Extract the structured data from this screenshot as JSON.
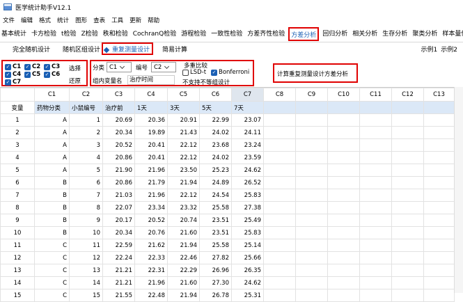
{
  "app": {
    "title": "医学统计助手V12.1"
  },
  "menu": [
    "文件",
    "编辑",
    "格式",
    "统计",
    "图形",
    "查表",
    "工具",
    "更新",
    "帮助"
  ],
  "tabs": [
    "基本统计",
    "卡方检验",
    "t检验",
    "Z检验",
    "秩和检验",
    "CochranQ检验",
    "游程检验",
    "一致性检验",
    "方差齐性检验",
    "方差分析",
    "回归分析",
    "相关分析",
    "生存分析",
    "聚类分析",
    "样本量估算"
  ],
  "active_tab_index": 9,
  "subtabs": [
    "完全随机设计",
    "随机区组设计",
    "重复测量设计",
    "简易计算"
  ],
  "active_subtab_index": 2,
  "examples": [
    "示例1",
    "示例2"
  ],
  "columns_panel": {
    "checkboxes": [
      {
        "label": "C1",
        "checked": true
      },
      {
        "label": "C2",
        "checked": true
      },
      {
        "label": "C3",
        "checked": true
      },
      {
        "label": "C4",
        "checked": true
      },
      {
        "label": "C5",
        "checked": true
      },
      {
        "label": "C6",
        "checked": true
      },
      {
        "label": "C7",
        "checked": true
      }
    ],
    "select_label": "选择",
    "restore_label": "还原"
  },
  "group_panel": {
    "group_label": "分类",
    "group_value": "C1",
    "id_label": "编号",
    "id_value": "C2",
    "within_label": "组内变量名",
    "within_value": "治疗时间"
  },
  "multi_compare": {
    "title": "多重比较",
    "options": [
      {
        "label": "LSD-t",
        "checked": false
      },
      {
        "label": "Bonferroni",
        "checked": true
      }
    ],
    "note": "不支持不等组设计"
  },
  "action": {
    "label": "计算重复测量设计方差分析"
  },
  "grid": {
    "col_headers": [
      "",
      "C1",
      "C2",
      "C3",
      "C4",
      "C5",
      "C6",
      "C7",
      "C8",
      "C9",
      "C10",
      "C11",
      "C12",
      "C13"
    ],
    "var_label": "变量",
    "var_names": [
      "药物分类",
      "小鼠编号",
      "治疗前",
      "1天",
      "3天",
      "5天",
      "7天",
      "",
      "",
      "",
      "",
      "",
      ""
    ],
    "rows": [
      [
        "1",
        "A",
        "1",
        "20.69",
        "20.36",
        "20.91",
        "22.99",
        "23.07"
      ],
      [
        "2",
        "A",
        "2",
        "20.34",
        "19.89",
        "21.43",
        "24.02",
        "24.11"
      ],
      [
        "3",
        "A",
        "3",
        "20.52",
        "20.41",
        "22.12",
        "23.68",
        "23.24"
      ],
      [
        "4",
        "A",
        "4",
        "20.86",
        "20.41",
        "22.12",
        "24.02",
        "23.59"
      ],
      [
        "5",
        "A",
        "5",
        "21.90",
        "21.96",
        "23.50",
        "25.23",
        "24.62"
      ],
      [
        "6",
        "B",
        "6",
        "20.86",
        "21.79",
        "21.94",
        "24.89",
        "26.52"
      ],
      [
        "7",
        "B",
        "7",
        "21.03",
        "21.96",
        "22.12",
        "24.54",
        "25.83"
      ],
      [
        "8",
        "B",
        "8",
        "22.07",
        "23.34",
        "23.32",
        "25.58",
        "27.38"
      ],
      [
        "9",
        "B",
        "9",
        "20.17",
        "20.52",
        "20.74",
        "23.51",
        "25.49"
      ],
      [
        "10",
        "B",
        "10",
        "20.34",
        "20.76",
        "21.60",
        "23.51",
        "25.83"
      ],
      [
        "11",
        "C",
        "11",
        "22.59",
        "21.62",
        "21.94",
        "25.58",
        "25.14"
      ],
      [
        "12",
        "C",
        "12",
        "22.24",
        "22.33",
        "22.46",
        "27.82",
        "25.66"
      ],
      [
        "13",
        "C",
        "13",
        "21.21",
        "22.31",
        "22.29",
        "26.96",
        "26.35"
      ],
      [
        "14",
        "C",
        "14",
        "21.21",
        "21.96",
        "21.60",
        "27.30",
        "24.62"
      ],
      [
        "15",
        "C",
        "15",
        "21.55",
        "22.48",
        "21.94",
        "26.78",
        "25.31"
      ]
    ]
  }
}
